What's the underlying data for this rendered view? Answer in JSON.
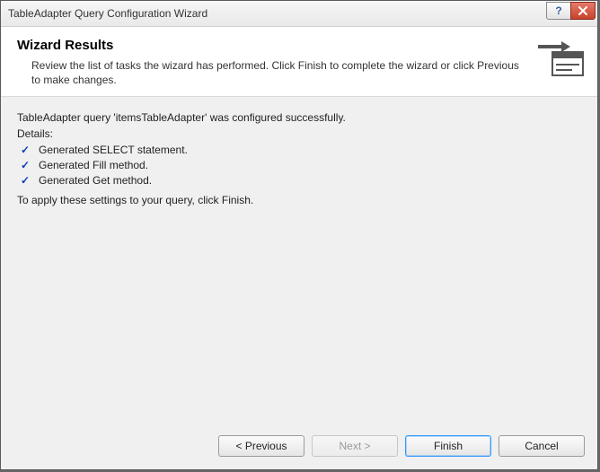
{
  "window": {
    "title": "TableAdapter Query Configuration Wizard"
  },
  "header": {
    "heading": "Wizard Results",
    "description": "Review the list of tasks the wizard has performed. Click Finish to complete the wizard or click Previous to make changes."
  },
  "body": {
    "status_line": "TableAdapter query 'itemsTableAdapter' was configured successfully.",
    "details_label": "Details:",
    "details": [
      "Generated SELECT statement.",
      "Generated Fill method.",
      "Generated Get method."
    ],
    "apply_hint": "To apply these settings to your query, click Finish."
  },
  "footer": {
    "previous": "< Previous",
    "next": "Next >",
    "finish": "Finish",
    "cancel": "Cancel",
    "next_enabled": false
  },
  "icons": {
    "help": "?",
    "checkmark": "✓"
  }
}
